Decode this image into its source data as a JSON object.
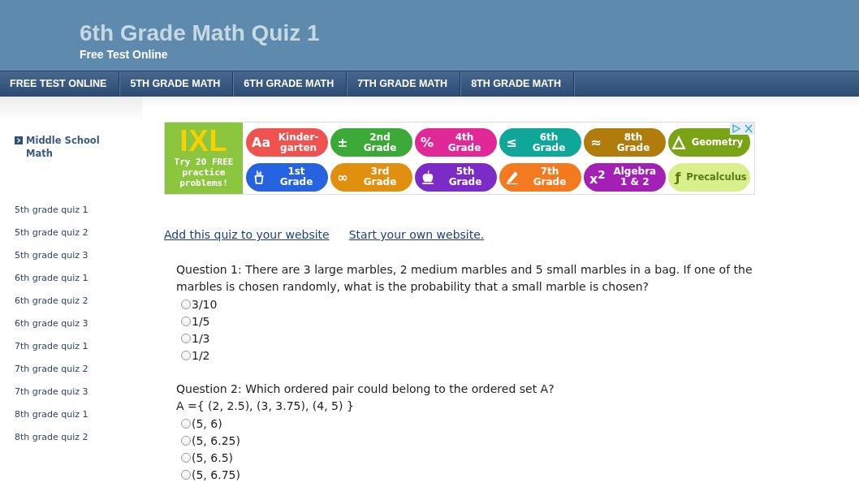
{
  "header": {
    "title": "6th Grade Math Quiz 1",
    "subtitle": "Free Test Online"
  },
  "nav": [
    "FREE TEST ONLINE",
    "5TH GRADE MATH",
    "6TH GRADE MATH",
    "7TH GRADE MATH",
    "8TH GRADE MATH"
  ],
  "sidebar": {
    "heading": "Middle School Math",
    "items": [
      "5th grade quiz 1",
      "5th grade quiz 2",
      "5th grade quiz 3",
      "6th grade quiz 1",
      "6th grade quiz 2",
      "6th grade quiz 3",
      "7th grade quiz 1",
      "7th grade quiz 2",
      "7th grade quiz 3",
      "8th grade quiz 1",
      "8th grade quiz 2"
    ]
  },
  "ad": {
    "logo": "IXL",
    "tagline": "Try 20 FREE practice problems!",
    "pills": [
      {
        "label": "Kinder-garten",
        "kind": "symbol",
        "glyph": "Aa",
        "color": "#f0524f"
      },
      {
        "label": "2nd Grade",
        "kind": "symbol",
        "glyph": "±",
        "color": "#3aa935"
      },
      {
        "label": "4th Grade",
        "kind": "symbol",
        "glyph": "%",
        "color": "#e02896"
      },
      {
        "label": "6th Grade",
        "kind": "symbol",
        "glyph": "≤",
        "color": "#0ea79a"
      },
      {
        "label": "8th Grade",
        "kind": "symbol",
        "glyph": "≈",
        "color": "#b07c0c"
      },
      {
        "label": "Geometry",
        "kind": "triangle",
        "color": "#7aa316"
      },
      {
        "label": "1st Grade",
        "kind": "cup",
        "color": "#2563e0"
      },
      {
        "label": "3rd Grade",
        "kind": "symbol",
        "glyph": "∞",
        "color": "#e0900e"
      },
      {
        "label": "5th Grade",
        "kind": "apple",
        "color": "#7b2bc8"
      },
      {
        "label": "7th Grade",
        "kind": "pencil",
        "color": "#f47a20"
      },
      {
        "label": "Algebra 1 & 2",
        "kind": "symbol",
        "glyph": "x$^{2}$",
        "color": "#a41fb5"
      },
      {
        "label": "Precalculus",
        "kind": "symbol",
        "glyph": "ƒ",
        "color": "#d8ef8c"
      }
    ]
  },
  "links": [
    "Add this quiz to your website",
    "Start your own website."
  ],
  "questions": [
    {
      "lines": [
        "Question 1: There are 3 large marbles, 2 medium marbles and 5 small marbles in a bag. If one of the marbles is chosen randomly, what is the probability that a small marble is chosen?"
      ],
      "options": [
        {
          "label": "3/10",
          "selected": false
        },
        {
          "label": "1/5",
          "selected": false
        },
        {
          "label": "1/3",
          "selected": false
        },
        {
          "label": "1/2",
          "selected": false
        }
      ]
    },
    {
      "lines": [
        "Question 2: Which ordered pair could belong to the ordered set A?",
        "A ={ (2, 2.5), (3, 3.75), (4, 5) }"
      ],
      "options": [
        {
          "label": "(5, 6)",
          "selected": false
        },
        {
          "label": "(5, 6.25)",
          "selected": false
        },
        {
          "label": "(5, 6.5)",
          "selected": false
        },
        {
          "label": "(5, 6.75)",
          "selected": false
        }
      ]
    }
  ]
}
